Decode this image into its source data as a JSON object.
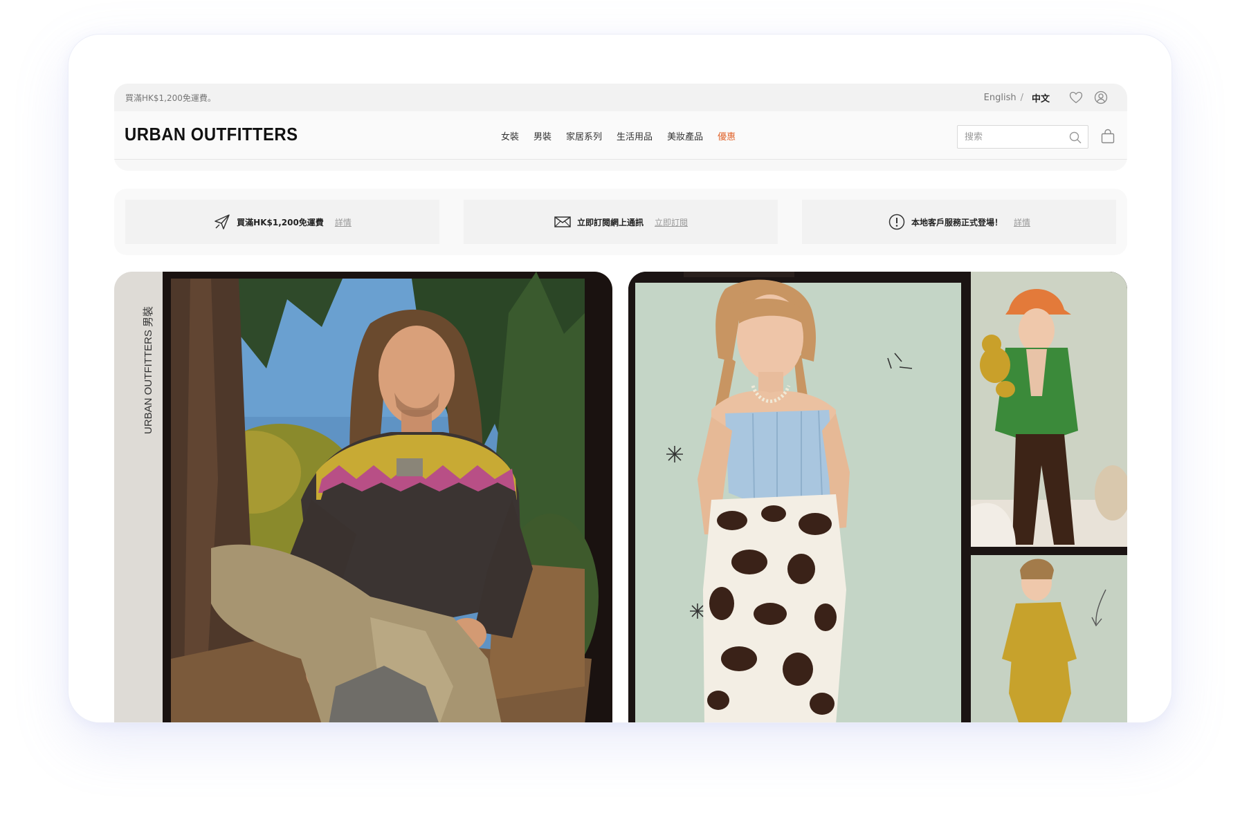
{
  "topbar": {
    "promo": "買滿HK$1,200免運費。",
    "lang_en": "English",
    "lang_sep": "/",
    "lang_zh": "中文",
    "icons": [
      "heart-icon",
      "account-icon"
    ]
  },
  "header": {
    "logo": "URBAN OUTFITTERS",
    "nav": [
      "女裝",
      "男裝",
      "家居系列",
      "生活用品",
      "美妝產品",
      "優惠"
    ],
    "search_placeholder": "搜索",
    "icons": [
      "search-icon",
      "shopping-bag-icon"
    ],
    "colors": {
      "sale": "#e0632b"
    }
  },
  "benefits": [
    {
      "icon": "paper-plane-icon",
      "text": "買滿HK$1,200免運費",
      "link": "詳情"
    },
    {
      "icon": "envelope-icon",
      "text": "立即訂閱網上通訊",
      "link": "立即訂閱"
    },
    {
      "icon": "exclamation-circle-icon",
      "text": "本地客戶服務正式登場！",
      "link": "詳情"
    }
  ],
  "hero": {
    "left_label": "URBAN OUTFITTERS 男裝"
  }
}
